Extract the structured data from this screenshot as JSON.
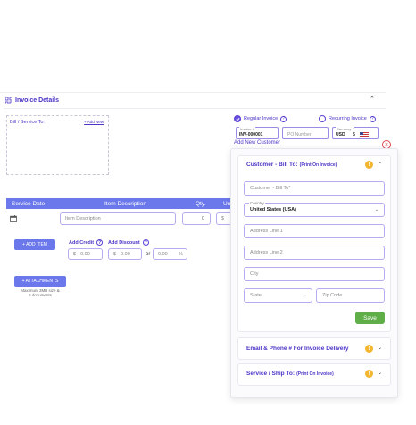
{
  "invoice": {
    "title": "Invoice Details",
    "bill_to_label": "Bill / Service To:",
    "add_new_label": "+ Add New",
    "regular_invoice": "Regular Invoice",
    "recurring_invoice": "Recurring Invoice",
    "invoice_no_label": "Invoice #",
    "invoice_no_value": "INV-000001",
    "po_number_placeholder": "PO Number",
    "currency_label": "Currency *",
    "currency_value": "USD",
    "currency_symbol": "$"
  },
  "table": {
    "headers": [
      "Service Date",
      "Item Description",
      "Qty.",
      "Un"
    ],
    "item_description_placeholder": "Item Description",
    "qty_value": "0",
    "unit_symbol": "$"
  },
  "actions": {
    "add_item": "+ ADD ITEM",
    "add_credit": "Add Credit",
    "add_discount": "Add Discount",
    "credit_symbol": "$",
    "credit_value": "0.00",
    "discount_symbol": "$",
    "discount_value": "0.00",
    "or_label": "or",
    "percent_value": "0.00",
    "percent_symbol": "%",
    "attachments": "+ ATTACHMENTS",
    "attachments_note_1": "Maximum 3MB size &",
    "attachments_note_2": "5 documents"
  },
  "modal": {
    "title": "Add New Customer",
    "close_symbol": "×",
    "bill_to_title": "Customer - Bill To:",
    "bill_to_sub": "(Print On Invoice)",
    "customer_placeholder": "Customer - Bill To*",
    "country_label": "Country",
    "country_value": "United States (USA)",
    "address1_placeholder": "Address Line 1",
    "address2_placeholder": "Address Line 2",
    "city_placeholder": "City",
    "state_placeholder": "State",
    "zip_placeholder": "Zip Code",
    "save_label": "Save",
    "email_section": "Email & Phone # For Invoice Delivery",
    "ship_to_title": "Service / Ship To:",
    "ship_to_sub": "(Print On Invoice)"
  },
  "colors": {
    "accent": "#5b3fd4",
    "table_header": "#6b78ec",
    "save_green": "#5fae48",
    "warning": "#f2b631",
    "close_red": "#e04848"
  }
}
